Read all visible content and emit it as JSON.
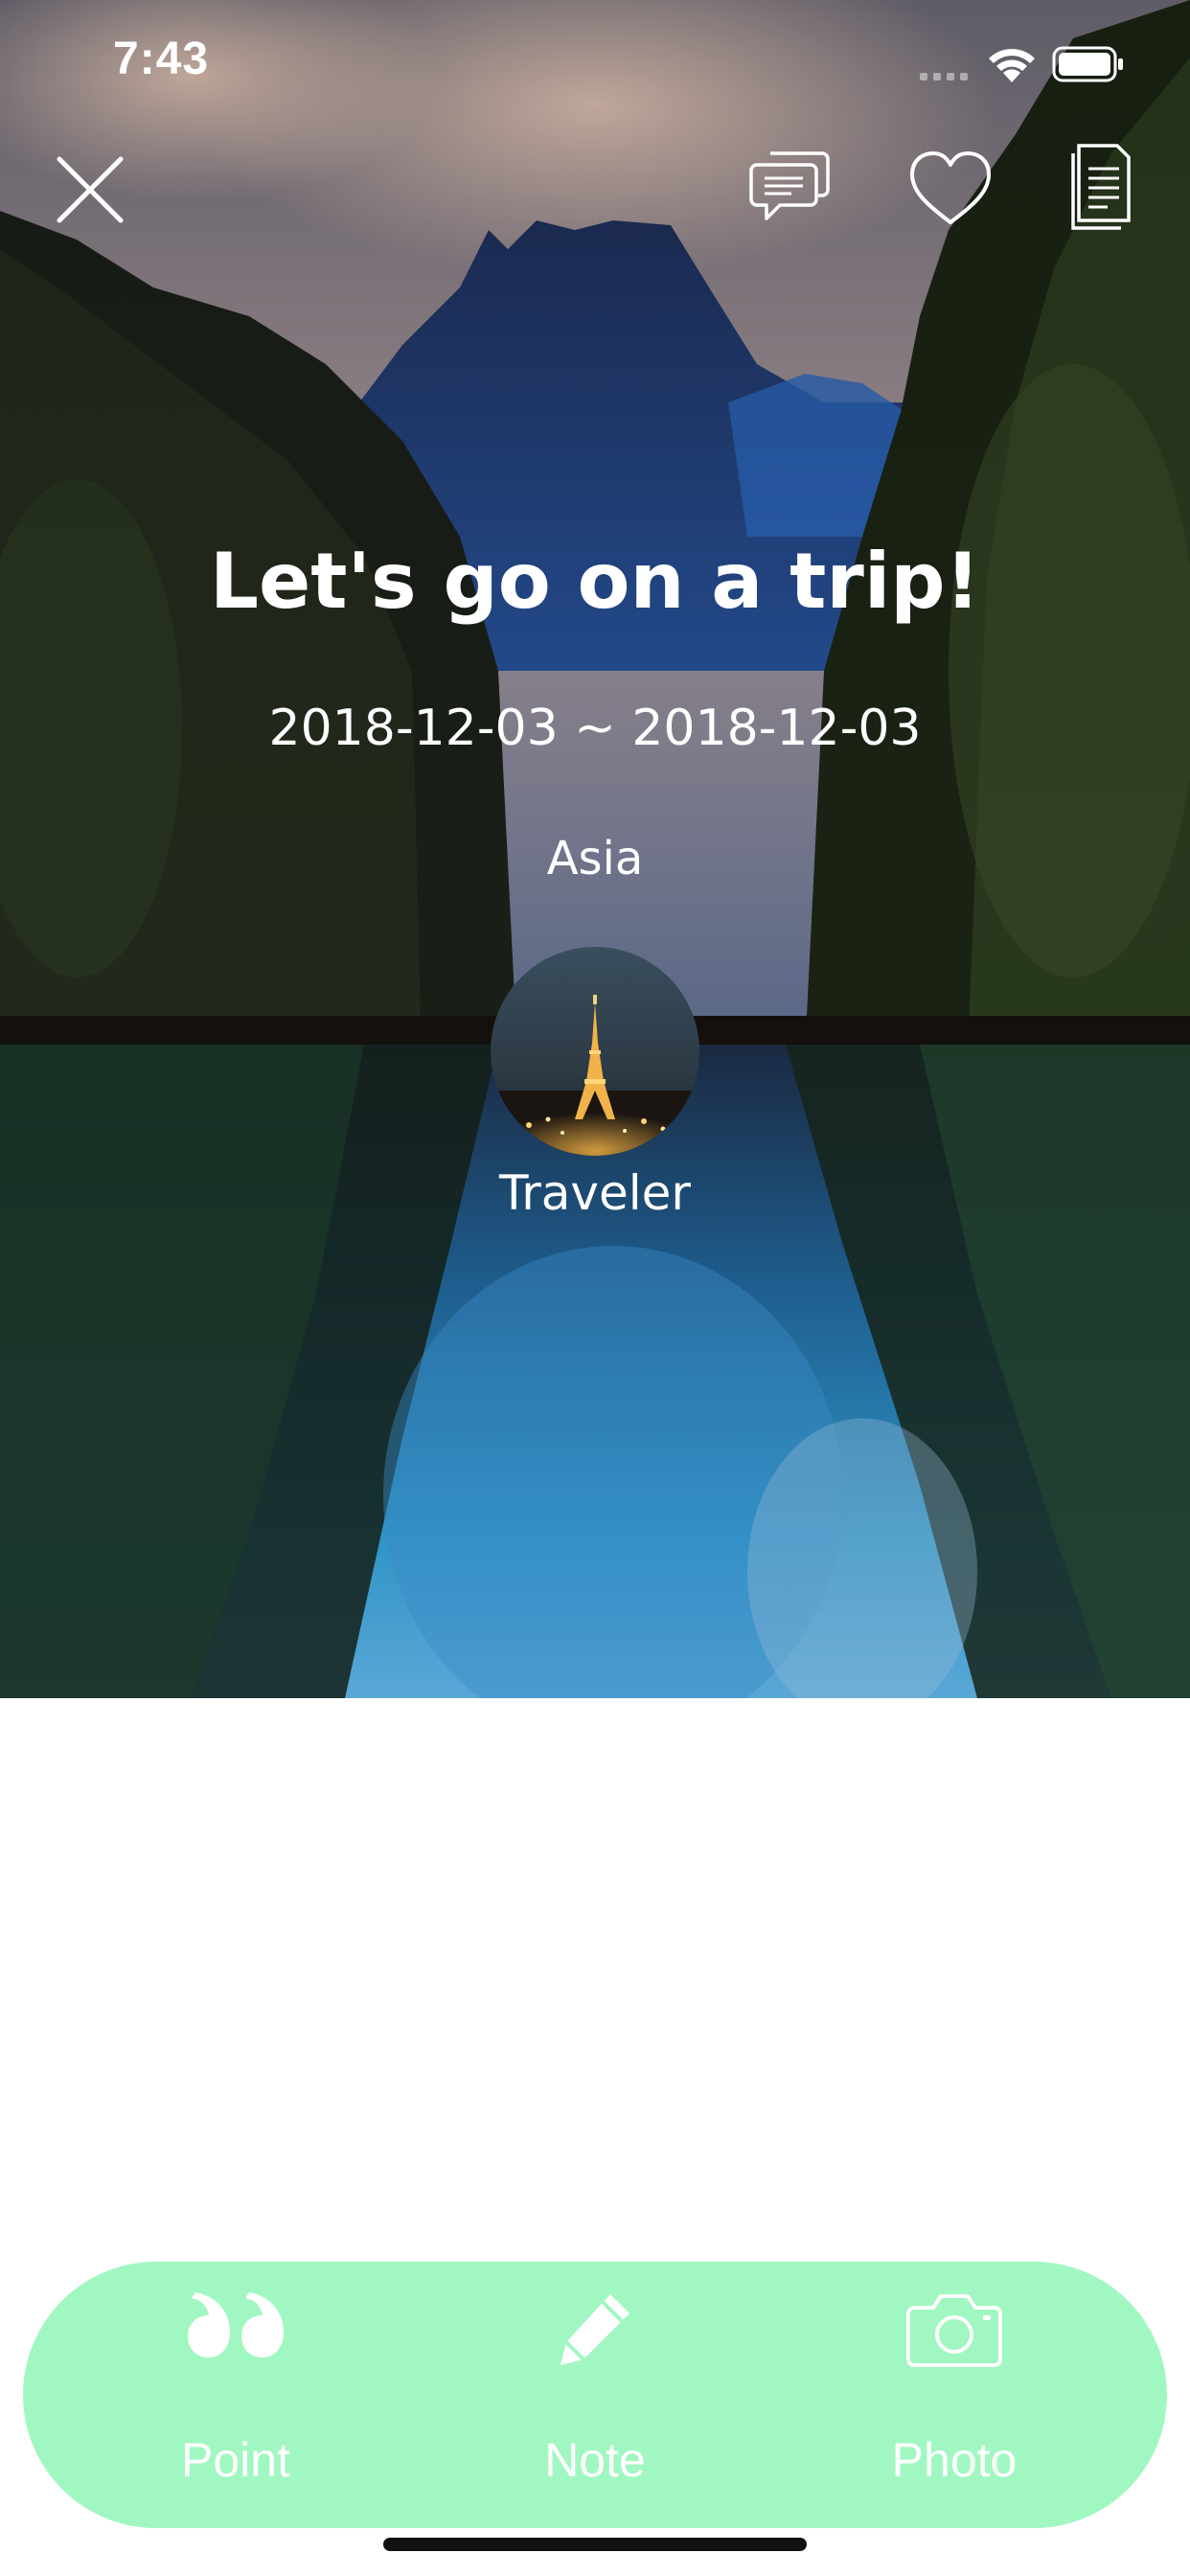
{
  "status_bar": {
    "time": "7:43"
  },
  "nav": {
    "close_icon": "close-icon",
    "comment_icon": "chat-bubbles-icon",
    "like_icon": "heart-icon",
    "doc_icon": "document-icon"
  },
  "trip": {
    "title": "Let's go on a trip!",
    "dates": "2018-12-03 ~ 2018-12-03",
    "region": "Asia",
    "traveler": "Traveler"
  },
  "actions": {
    "point_label": "Point",
    "note_label": "Note",
    "photo_label": "Photo",
    "point_icon": "quote-icon",
    "note_icon": "pencil-icon",
    "photo_icon": "camera-icon"
  },
  "colors": {
    "action_bar": "#a1f7c1",
    "text_on_hero": "#ffffff"
  }
}
